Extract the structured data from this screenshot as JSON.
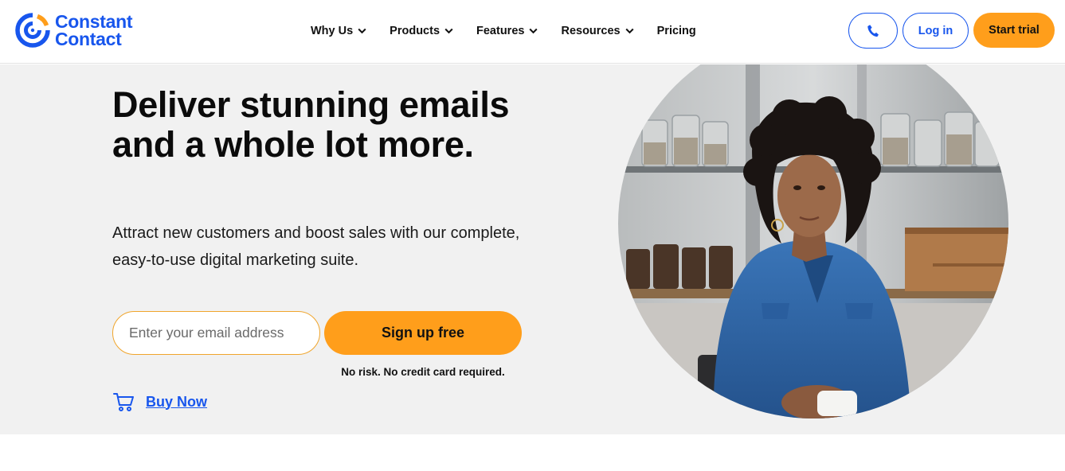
{
  "brand": {
    "name_line1": "Constant",
    "name_line2": "Contact",
    "color": "#1856ed",
    "accent": "#ff9e1b"
  },
  "nav": {
    "items": [
      {
        "label": "Why Us",
        "has_dropdown": true
      },
      {
        "label": "Products",
        "has_dropdown": true
      },
      {
        "label": "Features",
        "has_dropdown": true
      },
      {
        "label": "Resources",
        "has_dropdown": true
      },
      {
        "label": "Pricing",
        "has_dropdown": false
      }
    ]
  },
  "header_actions": {
    "phone_icon": "phone-icon",
    "login_label": "Log in",
    "trial_label": "Start trial"
  },
  "hero": {
    "headline": "Deliver stunning emails and a whole lot more.",
    "subtext": "Attract new customers and boost sales with our complete, easy-to-use digital marketing suite.",
    "email_placeholder": "Enter your email address",
    "signup_label": "Sign up free",
    "no_risk_text": "No risk. No credit card required.",
    "buy_now_label": "Buy Now",
    "buy_now_icon": "cart-icon",
    "image_subject": "woman-with-coffee-cup-photo"
  }
}
